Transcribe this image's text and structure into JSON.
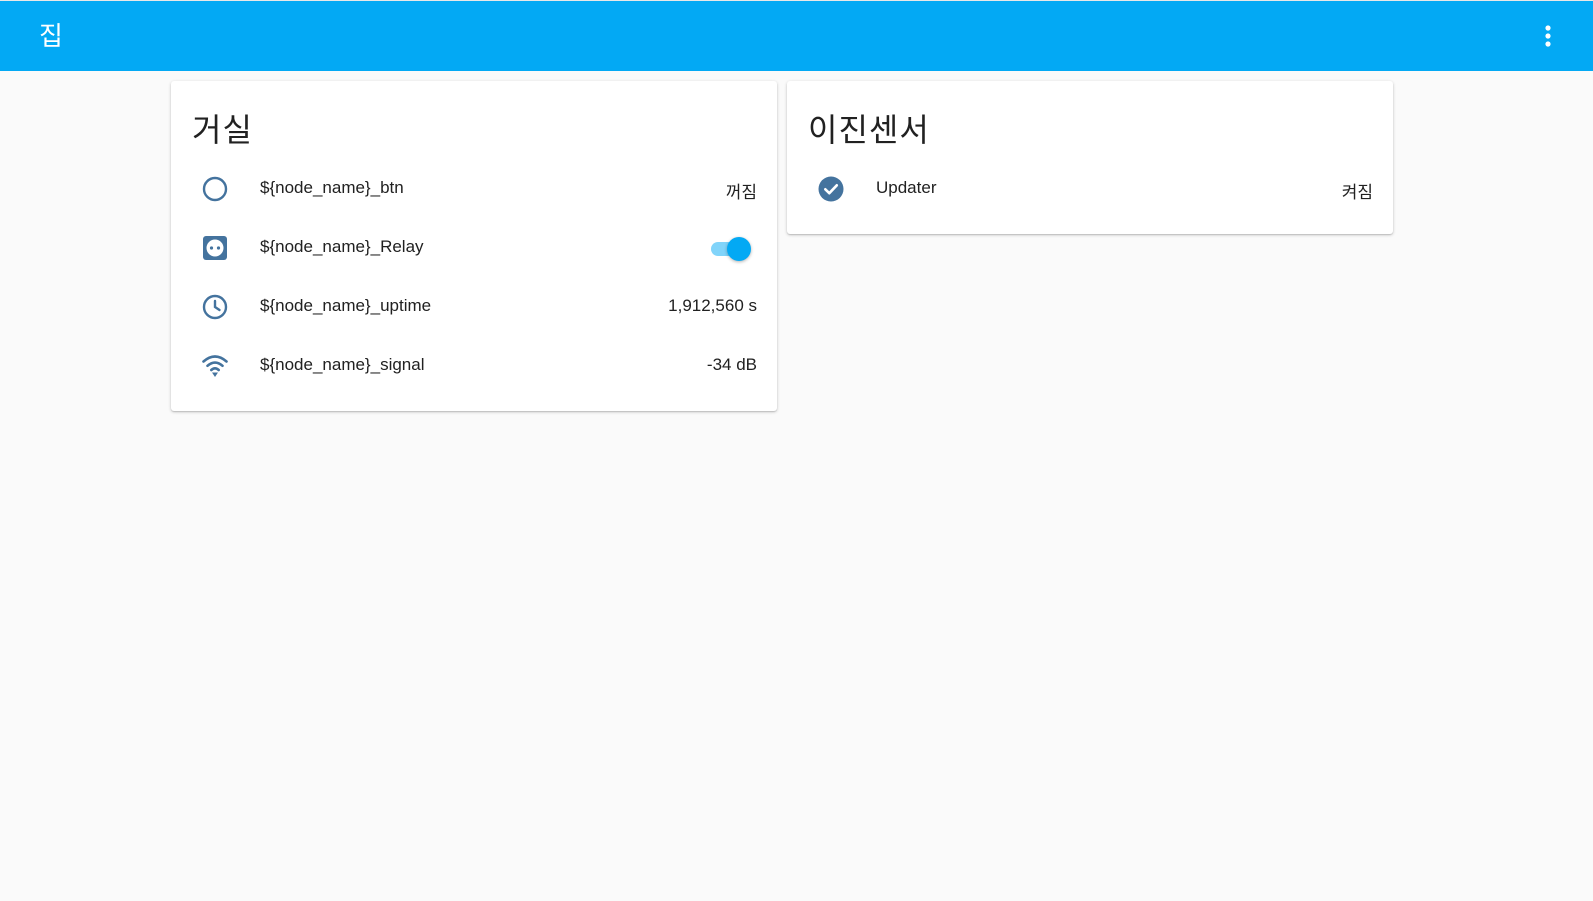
{
  "header": {
    "title": "집",
    "menu_icon": "dots-vertical-icon",
    "color": "#03a9f4"
  },
  "cards": [
    {
      "title": "거실",
      "rows": [
        {
          "icon": "circle-outline-icon",
          "name": "${node_name}_btn",
          "value": "꺼짐"
        },
        {
          "icon": "power-socket-icon",
          "name": "${node_name}_Relay",
          "toggle_on": true
        },
        {
          "icon": "clock-icon",
          "name": "${node_name}_uptime",
          "value": "1,912,560 s"
        },
        {
          "icon": "wifi-icon",
          "name": "${node_name}_signal",
          "value": "-34 dB"
        }
      ]
    },
    {
      "title": "이진센서",
      "rows": [
        {
          "icon": "check-circle-icon",
          "name": "Updater",
          "value": "켜짐"
        }
      ]
    }
  ],
  "colors": {
    "icon": "#44739e",
    "background": "#fafafa",
    "accent": "#03a9f4"
  }
}
